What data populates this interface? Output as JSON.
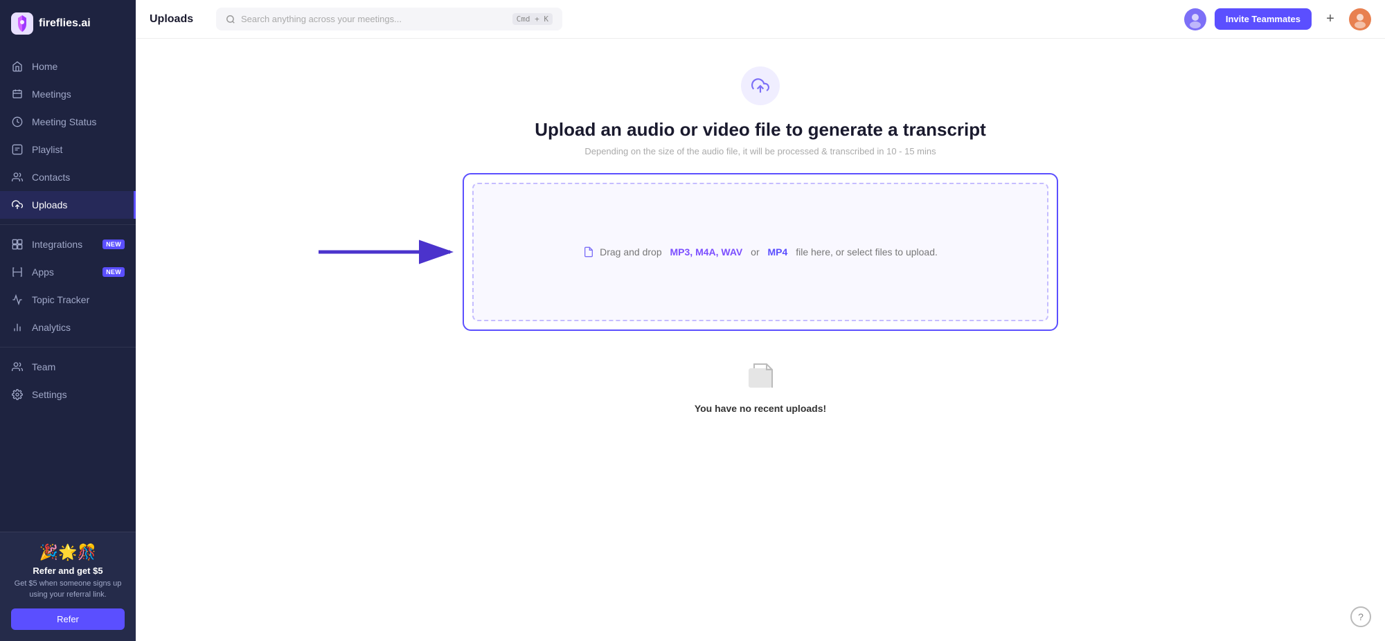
{
  "app": {
    "name": "fireflies.ai"
  },
  "sidebar": {
    "logo_text": "fireflies.ai",
    "nav_items": [
      {
        "id": "home",
        "label": "Home",
        "icon": "home"
      },
      {
        "id": "meetings",
        "label": "Meetings",
        "icon": "meetings"
      },
      {
        "id": "meeting-status",
        "label": "Meeting Status",
        "icon": "meeting-status"
      },
      {
        "id": "playlist",
        "label": "Playlist",
        "icon": "playlist"
      },
      {
        "id": "contacts",
        "label": "Contacts",
        "icon": "contacts"
      },
      {
        "id": "uploads",
        "label": "Uploads",
        "icon": "uploads",
        "active": true
      },
      {
        "id": "integrations",
        "label": "Integrations",
        "icon": "integrations",
        "badge": "NEW"
      },
      {
        "id": "apps",
        "label": "Apps",
        "icon": "apps",
        "badge": "NEW"
      },
      {
        "id": "topic-tracker",
        "label": "Topic Tracker",
        "icon": "topic-tracker"
      },
      {
        "id": "analytics",
        "label": "Analytics",
        "icon": "analytics"
      },
      {
        "id": "team",
        "label": "Team",
        "icon": "team"
      },
      {
        "id": "settings",
        "label": "Settings",
        "icon": "settings"
      }
    ],
    "referral": {
      "emoji": "🎉🌟🎊",
      "title": "Refer and get $5",
      "description": "Get $5 when someone signs up using your referral link.",
      "button_label": "Refer"
    }
  },
  "header": {
    "title": "Uploads",
    "search_placeholder": "Search anything across your meetings...",
    "search_shortcut": "Cmd + K",
    "invite_button_label": "Invite Teammates",
    "plus_label": "+"
  },
  "main": {
    "upload": {
      "icon_label": "upload-icon",
      "title": "Upload an audio or video file to generate a transcript",
      "subtitle": "Depending on the size of the audio file, it will be processed & transcribed in 10 - 15 mins",
      "dropzone": {
        "text_prefix": "Drag and drop",
        "formats_purple": "MP3, M4A, WAV",
        "or": "or",
        "format_blue": "MP4",
        "text_suffix": "file here, or select files to upload."
      }
    },
    "no_uploads": {
      "text": "You have no recent uploads!"
    }
  },
  "help": {
    "icon_label": "?"
  }
}
